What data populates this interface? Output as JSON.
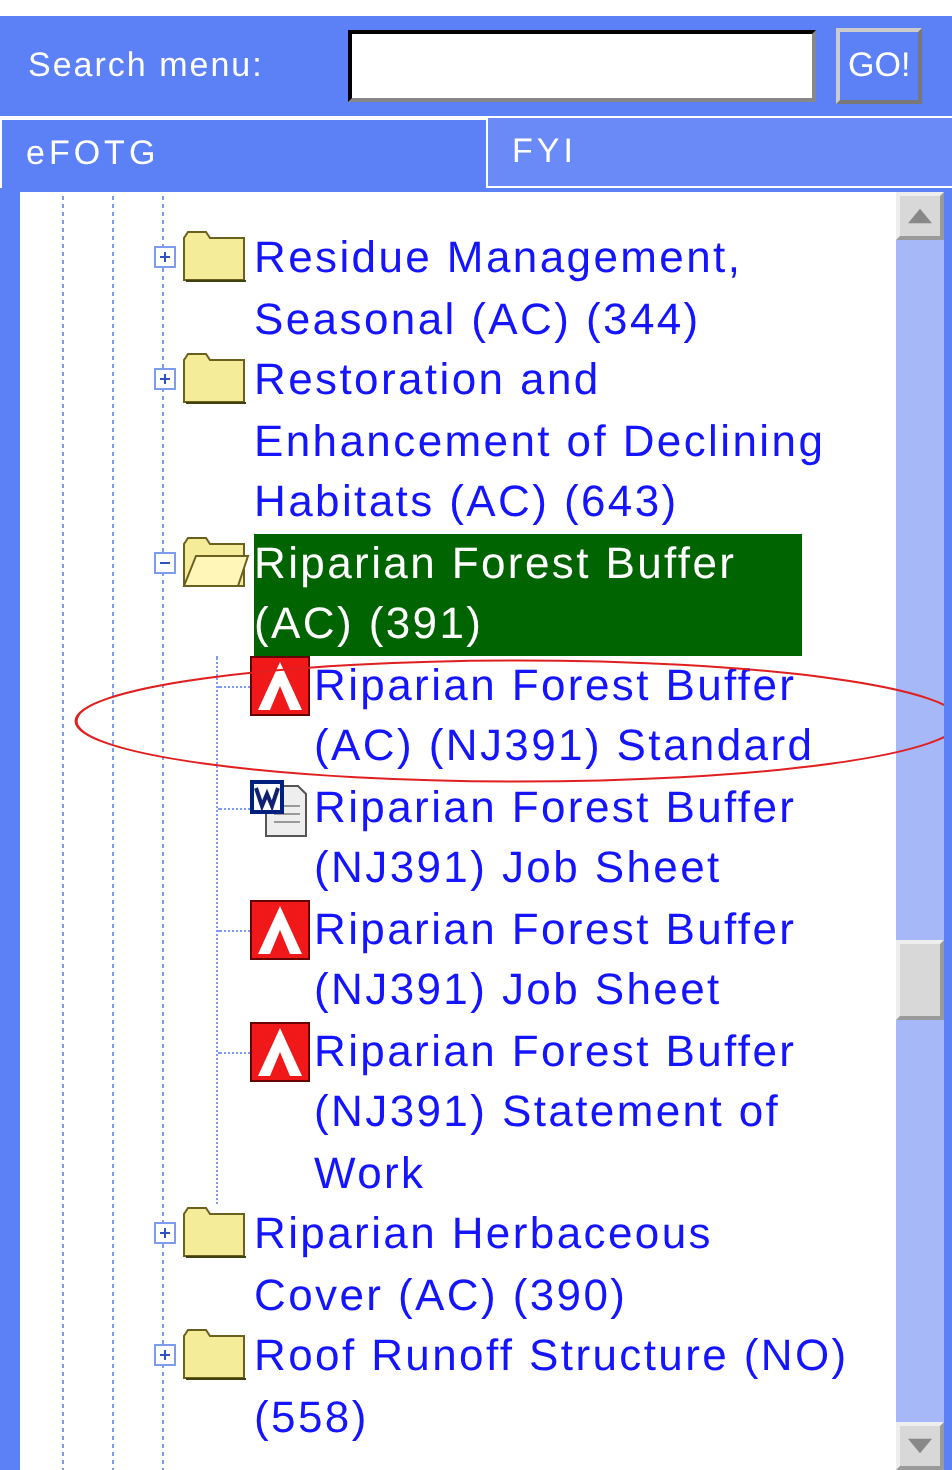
{
  "search": {
    "label": "Search menu:",
    "button": "GO!"
  },
  "tabs": [
    {
      "label": "eFOTG",
      "selected": true
    },
    {
      "label": "FYI",
      "selected": false
    }
  ],
  "tree": [
    {
      "kind": "folder",
      "label": "Residue Management, Seasonal (AC) (344)",
      "expanded": false,
      "selected": false
    },
    {
      "kind": "folder",
      "label": "Restoration and Enhancement of Declining Habitats (AC) (643)",
      "expanded": false,
      "selected": false
    },
    {
      "kind": "folder",
      "label": "Riparian Forest Buffer (AC) (391)",
      "expanded": true,
      "selected": true,
      "children": [
        {
          "kind": "pdf",
          "label": "Riparian Forest Buffer (AC) (NJ391) Standard"
        },
        {
          "kind": "word",
          "label": "Riparian Forest Buffer (NJ391) Job Sheet"
        },
        {
          "kind": "pdf",
          "label": "Riparian Forest Buffer (NJ391) Job Sheet"
        },
        {
          "kind": "pdf",
          "label": "Riparian Forest Buffer (NJ391) Statement of Work"
        }
      ]
    },
    {
      "kind": "folder",
      "label": "Riparian Herbaceous Cover (AC) (390)",
      "expanded": false,
      "selected": false
    },
    {
      "kind": "folder",
      "label": "Roof Runoff Structure (NO) (558)",
      "expanded": false,
      "selected": false
    }
  ],
  "annotation_ellipse": true
}
